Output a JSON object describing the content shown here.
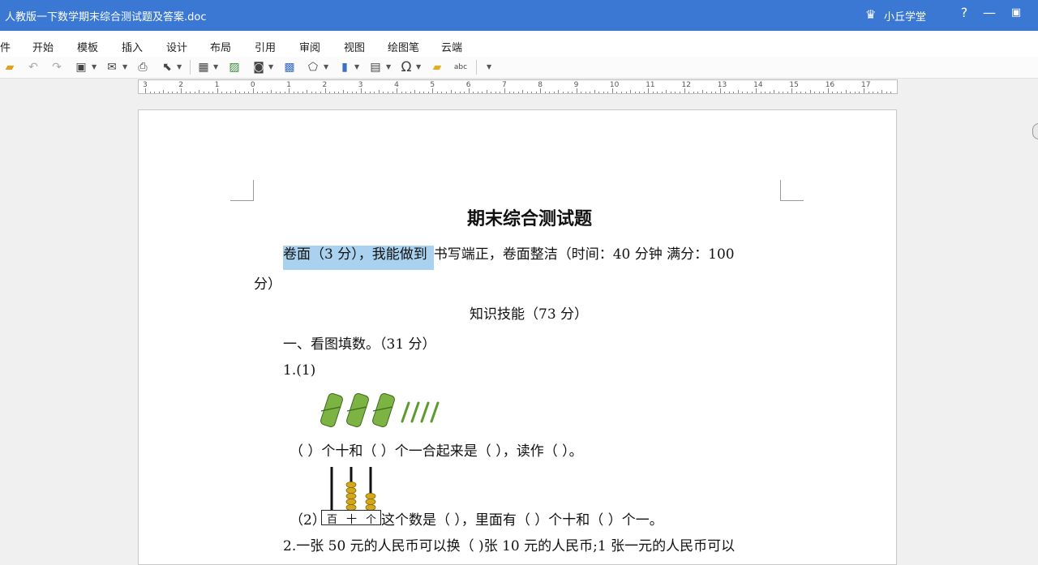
{
  "window": {
    "title": "人教版一下数学期末综合测试题及答案.doc",
    "user": "小丘学堂",
    "help_label": "?",
    "minimize_label": "—",
    "restore_label": "▣"
  },
  "menu": {
    "items": [
      "件",
      "开始",
      "模板",
      "插入",
      "设计",
      "布局",
      "引用",
      "审阅",
      "视图",
      "绘图笔",
      "云端"
    ]
  },
  "ruler": {
    "labels": [
      "3",
      "2",
      "1",
      "0",
      "1",
      "2",
      "3",
      "4",
      "5",
      "6",
      "7",
      "8",
      "9",
      "10",
      "11",
      "12",
      "13",
      "14",
      "15",
      "16",
      "17"
    ]
  },
  "icons": {
    "open": "folder-open-icon",
    "undo": "undo-icon",
    "redo": "redo-icon",
    "save": "save-icon",
    "mail": "mail-icon",
    "print": "print-icon",
    "select": "pointer-icon",
    "table": "table-icon",
    "image": "image-icon",
    "screenshot": "screenshot-icon",
    "chart": "chart-icon",
    "text": "textbox-icon",
    "symbol": "omega-icon",
    "note": "note-icon",
    "spell": "spellcheck-icon"
  },
  "document": {
    "title": "期末综合测试题",
    "intro_highlight": "卷面（3 分），我能做到",
    "intro_rest": "书写端正，卷面整洁（时间：40 分钟  满分：100",
    "intro_wrap": "分）",
    "section_title": "知识技能（73 分）",
    "part1": "一、看图填数。（31 分）",
    "q1_label": "1.(1)",
    "q1_blank": "（     ）个十和（     ）个一合起来是（     ），读作（     ）。",
    "q2_prefix": "（2）",
    "abacus_labels": [
      "百",
      "十",
      "个"
    ],
    "q2_text": "这个数是（     ），里面有（     ）个十和（     ）个一。",
    "q3_text": "2.一张 50 元的人民币可以换（   )张 10 元的人民币;1 张一元的人民币可以"
  },
  "colors": {
    "titlebar": "#3b78d4",
    "highlight": "#a9d2f0",
    "bundle_green": "#7cb342",
    "bead_gold": "#d4a81a"
  }
}
